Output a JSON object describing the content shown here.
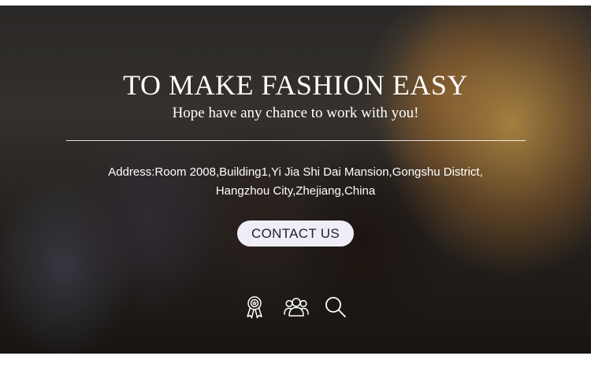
{
  "hero": {
    "headline": "TO MAKE FASHION EASY",
    "subline": "Hope have any chance to work with you!",
    "address_line1": "Address:Room 2008,Building1,Yi Jia Shi Dai Mansion,Gongshu District,",
    "address_line2": "Hangzhou City,Zhejiang,China",
    "contact_button": "CONTACT US"
  },
  "icons": [
    {
      "name": "award-ribbon-icon"
    },
    {
      "name": "users-group-icon"
    },
    {
      "name": "search-icon"
    }
  ],
  "colors": {
    "text": "#ffffff",
    "button_bg": "#efeef8",
    "button_text": "#222222",
    "page_bg": "#ffffff"
  }
}
